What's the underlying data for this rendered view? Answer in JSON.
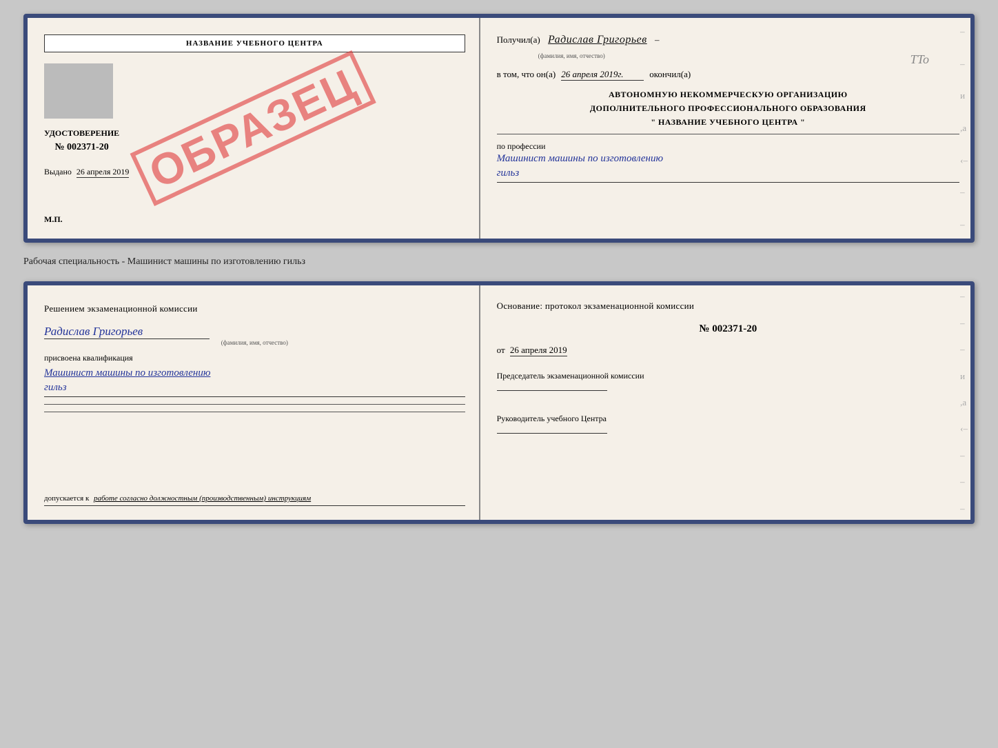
{
  "top_doc": {
    "left": {
      "school_name": "НАЗВАНИЕ УЧЕБНОГО ЦЕНТРА",
      "obrazec": "ОБРАЗЕЦ",
      "udostoverenie_label": "УДОСТОВЕРЕНИЕ",
      "number": "№ 002371-20",
      "vydano_label": "Выдано",
      "vydano_date": "26 апреля 2019",
      "mp_label": "М.П."
    },
    "right": {
      "poluchil_prefix": "Получил(а)",
      "recipient_name": "Радислав Григорьев",
      "fam_label": "(фамилия, имя, отчество)",
      "v_tom_prefix": "в том, что он(а)",
      "date_value": "26 апреля 2019г.",
      "okonchil": "окончил(а)",
      "org_line1": "АВТОНОМНУЮ НЕКОММЕРЧЕСКУЮ ОРГАНИЗАЦИЮ",
      "org_line2": "ДОПОЛНИТЕЛЬНОГО ПРОФЕССИОНАЛЬНОГО ОБРАЗОВАНИЯ",
      "org_line3": "\" НАЗВАНИЕ УЧЕБНОГО ЦЕНТРА \"",
      "profession_label": "по профессии",
      "profession_handwritten": "Машинист машины по изготовлению",
      "profession_handwritten2": "гильз"
    }
  },
  "specialty_label": "Рабочая специальность - Машинист машины по изготовлению гильз",
  "bottom_doc": {
    "left": {
      "komissia_text": "Решением экзаменационной комиссии",
      "fio_handwritten": "Радислав Григорьев",
      "fam_label": "(фамилия, имя, отчество)",
      "prisvoena_label": "присвоена квалификация",
      "kvalif_handwritten": "Машинист машины по изготовлению",
      "kvalif_handwritten2": "гильз",
      "dopusk_prefix": "допускается к",
      "dopusk_text": "работе согласно должностным (производственным) инструкциям"
    },
    "right": {
      "osnovanie_text": "Основание: протокол экзаменационной комиссии",
      "protocol_number": "№ 002371-20",
      "ot_label": "от",
      "protocol_date": "26 апреля 2019",
      "chairman_label": "Председатель экзаменационной комиссии",
      "rukovoditel_label": "Руководитель учебного Центра"
    }
  },
  "tto_mark": "TTo"
}
